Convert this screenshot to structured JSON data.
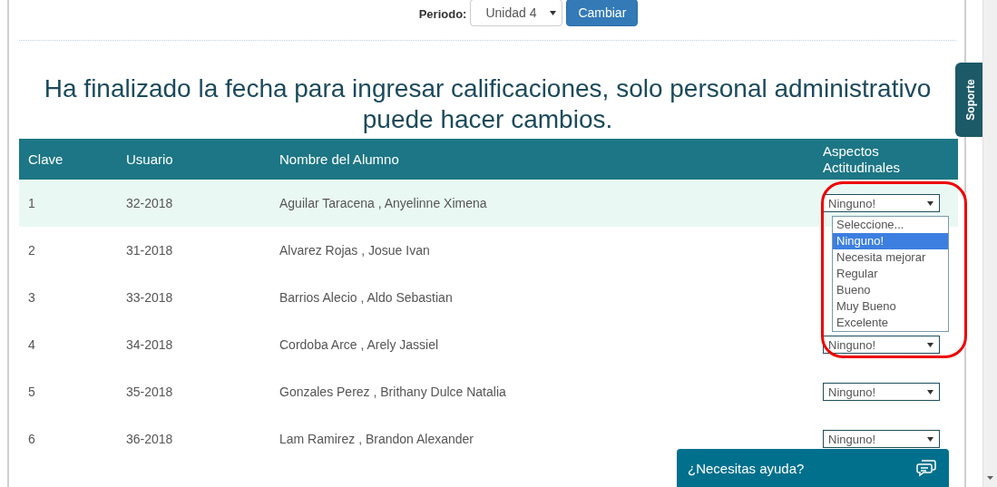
{
  "filter": {
    "label": "Periodo:",
    "value": "Unidad 4",
    "button": "Cambiar"
  },
  "notice": "Ha finalizado la fecha para ingresar calificaciones, solo personal administrativo puede hacer cambios.",
  "table": {
    "columns": [
      "Clave",
      "Usuario",
      "Nombre del Alumno",
      "Aspectos Actitudinales"
    ],
    "rows": [
      {
        "clave": "1",
        "usuario": "32-2018",
        "nombre": "Aguilar Taracena , Anyelinne Ximena",
        "grade": "Ninguno!",
        "highlighted": true
      },
      {
        "clave": "2",
        "usuario": "31-2018",
        "nombre": "Alvarez Rojas , Josue Ivan",
        "highlighted": false
      },
      {
        "clave": "3",
        "usuario": "33-2018",
        "nombre": "Barrios Alecio , Aldo Sebastian",
        "highlighted": false
      },
      {
        "clave": "4",
        "usuario": "34-2018",
        "nombre": "Cordoba Arce , Arely Jassiel",
        "grade": "Ninguno!",
        "highlighted": false
      },
      {
        "clave": "5",
        "usuario": "35-2018",
        "nombre": "Gonzales Perez , Brithany Dulce Natalia",
        "grade": "Ninguno!",
        "highlighted": false
      },
      {
        "clave": "6",
        "usuario": "36-2018",
        "nombre": "Lam Ramirez , Brandon Alexander",
        "grade": "Ninguno!",
        "highlighted": false
      }
    ]
  },
  "dropdown": {
    "options": [
      {
        "label": "Seleccione...",
        "selected": false
      },
      {
        "label": "Ninguno!",
        "selected": true
      },
      {
        "label": "Necesita mejorar",
        "selected": false
      },
      {
        "label": "Regular",
        "selected": false
      },
      {
        "label": "Bueno",
        "selected": false
      },
      {
        "label": "Muy Bueno",
        "selected": false
      },
      {
        "label": "Excelente",
        "selected": false
      }
    ]
  },
  "support_tab": "Soporte",
  "chat": {
    "label": "¿Necesitas ayuda?"
  }
}
